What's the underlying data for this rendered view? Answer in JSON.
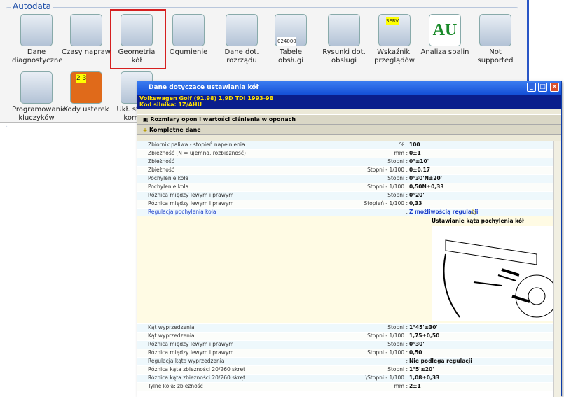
{
  "group_title": "Autodata",
  "tiles": [
    "Dane diagnostyczne",
    "Czasy napraw",
    "Geometria kół",
    "Ogumienie",
    "Dane dot. rozrządu",
    "Tabele obsługi",
    "Rysunki dot. obsługi",
    "Wskaźniki przeglądów",
    "Analiza spalin",
    "Not supported"
  ],
  "tiles2": [
    "Programowanie kluczyków",
    "Kody usterek",
    "Ukł. ster... - komp..."
  ],
  "badges": {
    "serv": "SERV",
    "au": "AU",
    "odo": "024000",
    "kody": "2 3"
  },
  "dialog": {
    "title": "Dane dotyczące ustawiania kół",
    "vehicle": "Volkswagen  Golf (91.98) 1,9D TDI 1993-98",
    "engine": "Kod silnika: 1Z/AHU",
    "section1": "Rozmiary opon i wartości ciśnienia w oponach",
    "section2": "Kompletne dane"
  },
  "rows_top": [
    {
      "l": "Zbiornik paliwa - stopień napełnienia",
      "u": "% :",
      "v": "100"
    },
    {
      "l": "Zbieżność (N = ujemna, rozbieżność)",
      "u": "mm :",
      "v": "0±1"
    },
    {
      "l": "Zbieżność",
      "u": "Stopni :",
      "v": "0°±10'"
    },
    {
      "l": "Zbieżność",
      "u": "Stopni - 1/100 :",
      "v": "0±0,17"
    },
    {
      "l": "Pochylenie koła",
      "u": "Stopni :",
      "v": "0°30'N±20'"
    },
    {
      "l": "Pochylenie koła",
      "u": "Stopni - 1/100 :",
      "v": "0,50N±0,33"
    },
    {
      "l": "Różnica między lewym i prawym",
      "u": "Stopni :",
      "v": "0°20'"
    },
    {
      "l": "Różnica między lewym i prawym",
      "u": "Stopień - 1/100 :",
      "v": "0,33"
    },
    {
      "l": "Regulacja pochylenia koła",
      "u": ":",
      "v": "Z możliwością regulacji",
      "blue": true
    }
  ],
  "diagram_title": "Ustawianie kąta pochylenia kół",
  "rows_bottom": [
    {
      "l": "Kąt wyprzedzenia",
      "u": "Stopni :",
      "v": "1°45'±30'"
    },
    {
      "l": "Kąt wyprzedzenia",
      "u": "Stopni - 1/100 :",
      "v": "1,75±0,50"
    },
    {
      "l": "Różnica między lewym i prawym",
      "u": "Stopni :",
      "v": "0°30'"
    },
    {
      "l": "Różnica między lewym i prawym",
      "u": "Stopni - 1/100 :",
      "v": "0,50"
    },
    {
      "l": "Regulacja kąta wyprzedzenia",
      "u": ":",
      "v": "Nie podlega regulacji"
    },
    {
      "l": "Różnica kąta zbieżności 20/260 skręt",
      "u": "Stopni :",
      "v": "1°5'±20'"
    },
    {
      "l": "Różnica kąta zbieżności 20/260 skręt",
      "u": "\\Stopni - 1/100 :",
      "v": "1,08±0,33"
    },
    {
      "l": "Tylne koła: zbieżność",
      "u": "mm :",
      "v": "2±1"
    }
  ]
}
